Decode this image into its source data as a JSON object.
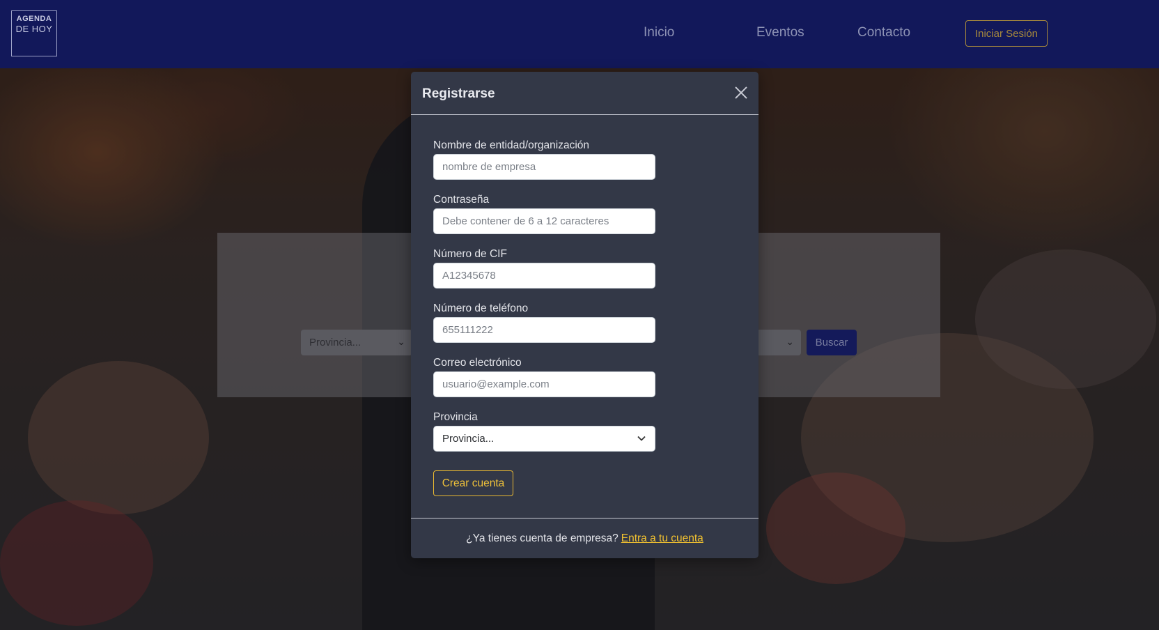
{
  "brand": {
    "line1": "AGENDA",
    "line2": "DE HOY"
  },
  "nav": {
    "items": [
      {
        "label": "Inicio"
      },
      {
        "label": "Eventos"
      },
      {
        "label": "Contacto"
      }
    ],
    "login_label": "Iniciar Sesión"
  },
  "background": {
    "province_select": "Provincia...",
    "search_button": "Buscar"
  },
  "modal": {
    "title": "Registrarse",
    "fields": {
      "organization": {
        "label": "Nombre de entidad/organización",
        "placeholder": "nombre de empresa"
      },
      "password": {
        "label": "Contraseña",
        "placeholder": "Debe contener de 6 a 12 caracteres"
      },
      "cif": {
        "label": "Número de CIF",
        "placeholder": "A12345678"
      },
      "phone": {
        "label": "Número de teléfono",
        "placeholder": "655111222"
      },
      "email": {
        "label": "Correo electrónico",
        "placeholder": "usuario@example.com"
      },
      "province": {
        "label": "Provincia",
        "selected": "Provincia..."
      }
    },
    "submit_label": "Crear cuenta",
    "footer": {
      "text": "¿Ya tienes cuenta de empresa?",
      "link": "Entra a tu cuenta"
    }
  },
  "colors": {
    "navbar": "#12185a",
    "modal_bg": "#333847",
    "accent": "#f0c23a"
  }
}
